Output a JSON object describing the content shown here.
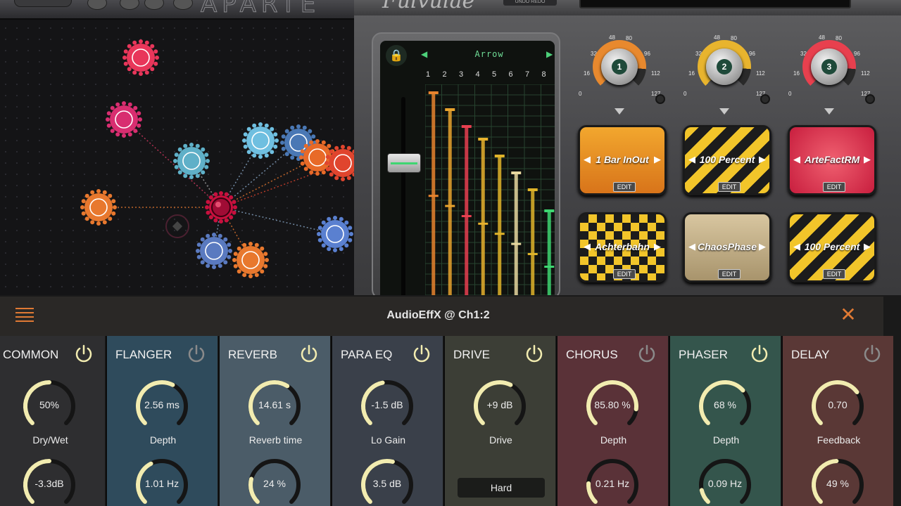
{
  "graph": {
    "nodes": [
      {
        "name": "clock-node",
        "color": "#e8365a",
        "icon": "clock-icon"
      },
      {
        "name": "broadcast-node",
        "color": "#d82e70",
        "icon": "broadcast-icon"
      },
      {
        "name": "splitter-node",
        "color": "#5fb0c8",
        "icon": "split-icon"
      },
      {
        "name": "wave-node",
        "color": "#6fbfe0",
        "icon": "w-wave-icon"
      },
      {
        "name": "gear-node",
        "color": "#4a78b5",
        "icon": "gear-icon"
      },
      {
        "name": "envelope-node",
        "color": "#e86a28",
        "icon": "envelope-icon"
      },
      {
        "name": "loop-node",
        "color": "#e0452e",
        "icon": "loop-icon"
      },
      {
        "name": "hub-node",
        "color": "#c8103e",
        "icon": "hub-icon"
      },
      {
        "name": "mod-node",
        "color": "#e8782e",
        "icon": "wave-shape-icon"
      },
      {
        "name": "diamond-node",
        "color": "#4b2030",
        "icon": "diamond-icon"
      },
      {
        "name": "random-node",
        "color": "#5a7ac0",
        "icon": "cross-circle-icon"
      },
      {
        "name": "lfo-node",
        "color": "#e8782e",
        "icon": "lfo-icon"
      },
      {
        "name": "bulb-node",
        "color": "#5a80d0",
        "icon": "bulb-icon"
      }
    ]
  },
  "device": {
    "sequencer": {
      "pattern_name": "Arrow",
      "steps": [
        "1",
        "2",
        "3",
        "4",
        "5",
        "6",
        "7",
        "8"
      ],
      "step_levels": [
        0.96,
        0.88,
        0.8,
        0.74,
        0.66,
        0.58,
        0.5,
        0.4
      ],
      "step_colors": [
        "#e8842e",
        "#e8a32e",
        "#e84050",
        "#e8b22e",
        "#e0b42a",
        "#e8d8a0",
        "#e0b42a",
        "#3ed671"
      ]
    },
    "macro_knobs": [
      {
        "number": "1",
        "color": "#e8892e",
        "scale": [
          "0",
          "16",
          "32",
          "48",
          "64",
          "80",
          "96",
          "112",
          "127"
        ]
      },
      {
        "number": "2",
        "color": "#e8b42e",
        "scale": [
          "0",
          "16",
          "32",
          "48",
          "64",
          "80",
          "96",
          "112",
          "127"
        ]
      },
      {
        "number": "3",
        "color": "#e8404e",
        "scale": [
          "0",
          "16",
          "32",
          "48",
          "64",
          "80",
          "96",
          "112",
          "127"
        ]
      }
    ],
    "presets_row1": [
      {
        "label": "1 Bar InOut",
        "edit": "EDIT"
      },
      {
        "label": "100 Percent",
        "edit": "EDIT"
      },
      {
        "label": "ArteFactRM",
        "edit": "EDIT"
      }
    ],
    "presets_row2": [
      {
        "label": "Achterbahn",
        "edit": "EDIT"
      },
      {
        "label": "ChaosPhase",
        "edit": "EDIT"
      },
      {
        "label": "100 Percent",
        "edit": "EDIT"
      }
    ]
  },
  "fx": {
    "title": "AudioEffX @ Ch1:2",
    "close_icon": "close-icon",
    "menu_icon": "hamburger-icon",
    "modules": [
      {
        "name": "COMMON",
        "bg": "#2e2e30",
        "on": true,
        "p1": {
          "value": "50%",
          "label": "Dry/Wet",
          "level": 0.5
        },
        "p2": {
          "value": "-3.3dB",
          "label": "",
          "level": 0.5
        }
      },
      {
        "name": "FLANGER",
        "bg": "#2f4b5c",
        "on": false,
        "p1": {
          "value": "2.56  ms",
          "label": "Depth",
          "level": 0.6
        },
        "p2": {
          "value": "1.01  Hz",
          "label": "",
          "level": 0.4
        }
      },
      {
        "name": "REVERB",
        "bg": "#4b5c68",
        "on": true,
        "p1": {
          "value": "14.61 s",
          "label": "Reverb time",
          "level": 0.62
        },
        "p2": {
          "value": "24 %",
          "label": "",
          "level": 0.22
        }
      },
      {
        "name": "PARA EQ",
        "bg": "#3a404a",
        "on": true,
        "p1": {
          "value": "-1.5 dB",
          "label": "Lo Gain",
          "level": 0.46
        },
        "p2": {
          "value": "3.5 dB",
          "label": "",
          "level": 0.55
        }
      },
      {
        "name": "DRIVE",
        "bg": "#3c3e36",
        "on": true,
        "p1": {
          "value": "+9 dB",
          "label": "Drive",
          "level": 0.6
        },
        "button": "Hard"
      },
      {
        "name": "CHORUS",
        "bg": "#5a3238",
        "on": false,
        "p1": {
          "value": "85.80 %",
          "label": "Depth",
          "level": 0.86
        },
        "p2": {
          "value": "0.21  Hz",
          "label": "",
          "level": 0.18
        }
      },
      {
        "name": "PHASER",
        "bg": "#34554c",
        "on": true,
        "p1": {
          "value": "68 %",
          "label": "Depth",
          "level": 0.68
        },
        "p2": {
          "value": "0.09 Hz",
          "label": "",
          "level": 0.12
        }
      },
      {
        "name": "DELAY",
        "bg": "#5a3836",
        "on": false,
        "p1": {
          "value": "0.70",
          "label": "Feedback",
          "level": 0.7
        },
        "p2": {
          "value": "49  %",
          "label": "",
          "level": 0.49
        }
      }
    ]
  },
  "colors": {
    "accent": "#e07a34",
    "knob_arc": "#f2ecb0",
    "knob_track": "#151515",
    "power_on": "#f2ecb0",
    "power_off": "#8a8a8a"
  }
}
